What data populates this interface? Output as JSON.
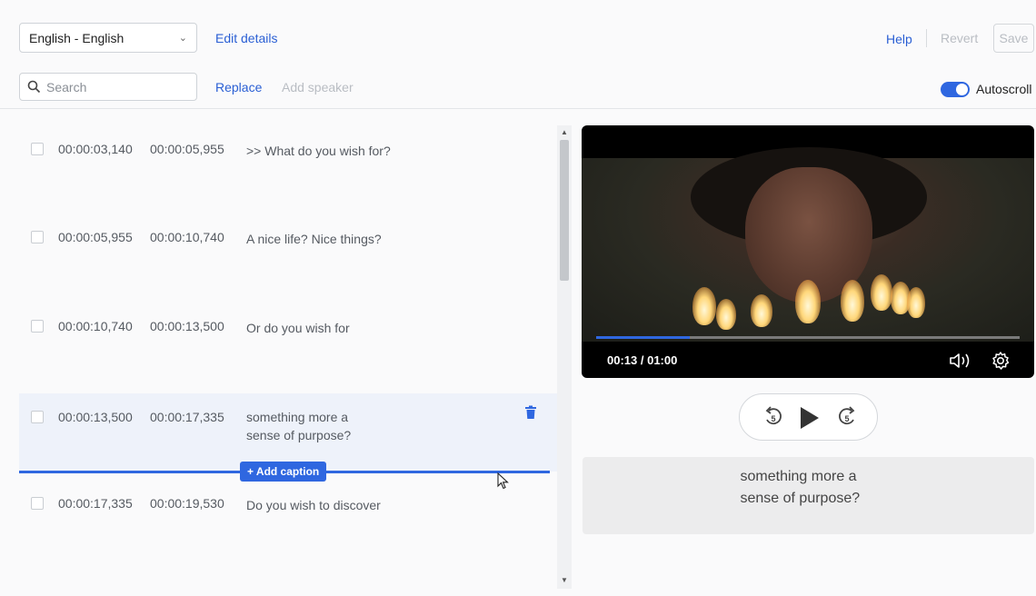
{
  "header": {
    "language_select": {
      "value": "English - English"
    },
    "edit_details": "Edit details",
    "search": {
      "placeholder": "Search",
      "value": ""
    },
    "replace": "Replace",
    "add_speaker": "Add speaker",
    "help": "Help",
    "revert": "Revert",
    "save": "Save",
    "autoscroll": {
      "label": "Autoscroll",
      "enabled": true
    }
  },
  "captions": [
    {
      "start": "00:00:03,140",
      "end": "00:00:05,955",
      "text": ">> What do you wish for?"
    },
    {
      "start": "00:00:05,955",
      "end": "00:00:10,740",
      "text": "A nice life? Nice things?"
    },
    {
      "start": "00:00:10,740",
      "end": "00:00:13,500",
      "text": "Or do you wish for"
    },
    {
      "start": "00:00:13,500",
      "end": "00:00:17,335",
      "text": "something more a sense of purpose?",
      "active": true
    },
    {
      "start": "00:00:17,335",
      "end": "00:00:19,530",
      "text": "Do you wish to discover"
    }
  ],
  "add_caption": "+ Add caption",
  "player": {
    "time": "00:13 / 01:00",
    "progress": 0.22,
    "current_caption": "something more a sense of purpose?"
  },
  "icons": [
    "chevron-down-icon",
    "search-icon",
    "trash-icon",
    "volume-icon",
    "settings-gear-icon",
    "rewind-5-icon",
    "play-icon",
    "forward-5-icon",
    "mouse-cursor-icon"
  ],
  "colors": {
    "accent": "#2f67e0",
    "disabled": "#b9bdc3"
  }
}
